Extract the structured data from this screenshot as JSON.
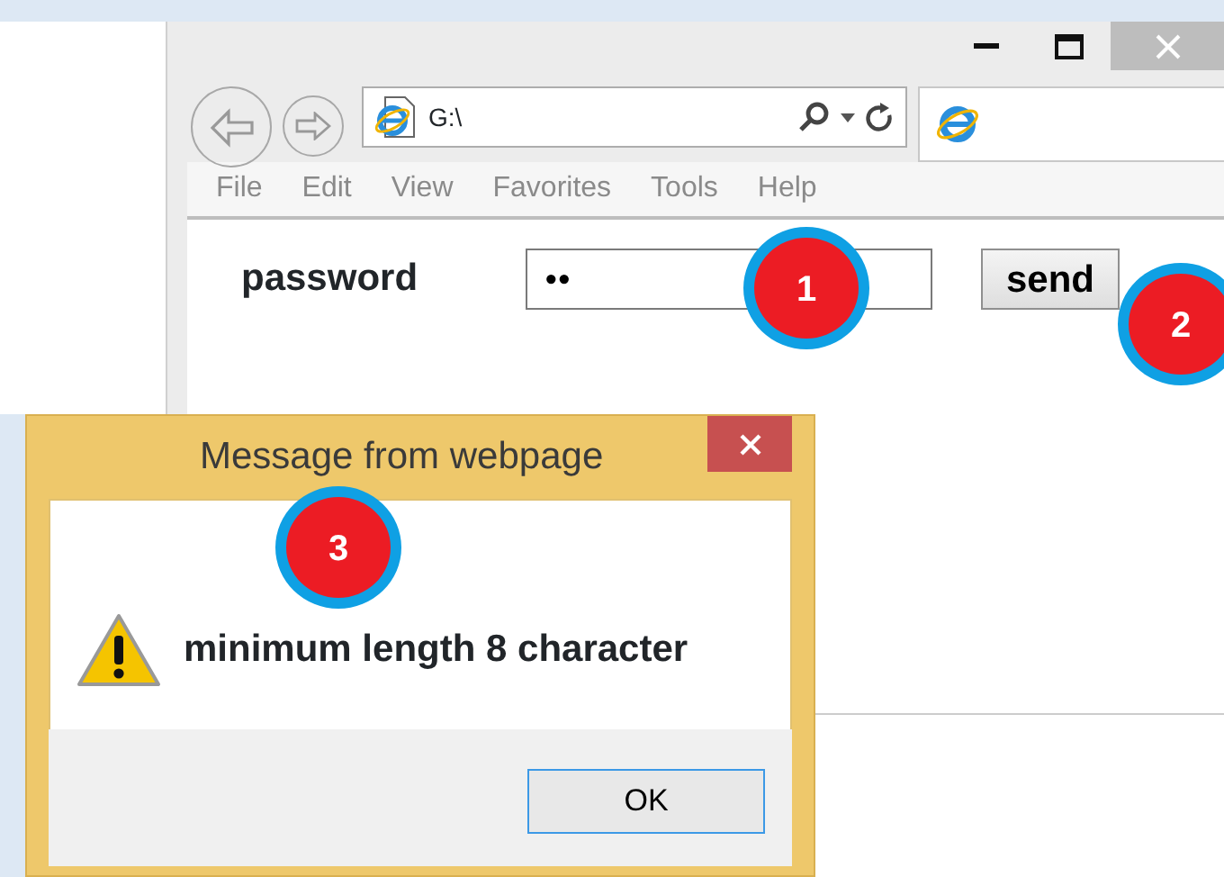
{
  "browser": {
    "address": "G:\\",
    "menu": [
      "File",
      "Edit",
      "View",
      "Favorites",
      "Tools",
      "Help"
    ],
    "form": {
      "label": "password",
      "value": "••",
      "button": "send"
    }
  },
  "dialog": {
    "title": "Message from webpage",
    "message": "minimum length 8 character",
    "button": "OK"
  },
  "annotations": [
    {
      "label": "1"
    },
    {
      "label": "2"
    },
    {
      "label": "3"
    }
  ]
}
